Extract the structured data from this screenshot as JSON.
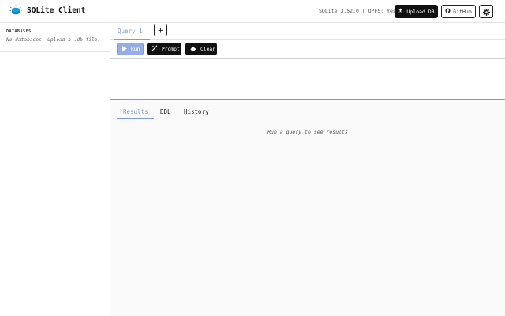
{
  "header": {
    "logo_icon": "database-spark-icon",
    "title": "SQLite Client",
    "version_text": "SQLite 3.52.0 | OPFS: Yes",
    "upload_label": "Upload DB",
    "upload_icon": "upload-icon",
    "github_label": "GitHub",
    "github_icon": "github-icon",
    "settings_icon": "gear-icon"
  },
  "sidebar": {
    "heading": "DATABASES",
    "empty_text": "No databases. Upload a .db file."
  },
  "query_tabs": {
    "tabs": [
      {
        "label": "Query 1",
        "active": true
      }
    ],
    "add_label": "+"
  },
  "toolbar": {
    "run_label": "Run",
    "run_icon": "play-icon",
    "prompt_label": "Prompt",
    "prompt_icon": "magic-wand-icon",
    "clear_label": "Clear",
    "clear_icon": "eraser-icon"
  },
  "editor": {
    "value": ""
  },
  "results": {
    "tabs": [
      {
        "label": "Results",
        "active": true
      },
      {
        "label": "DDL",
        "active": false
      },
      {
        "label": "History",
        "active": false
      }
    ],
    "empty_message": "Run a query to see results"
  },
  "colors": {
    "accent": "#7e9ae0",
    "run_button": "#95ace6",
    "dark_button": "#111111",
    "logo": "#1a9bd7"
  }
}
